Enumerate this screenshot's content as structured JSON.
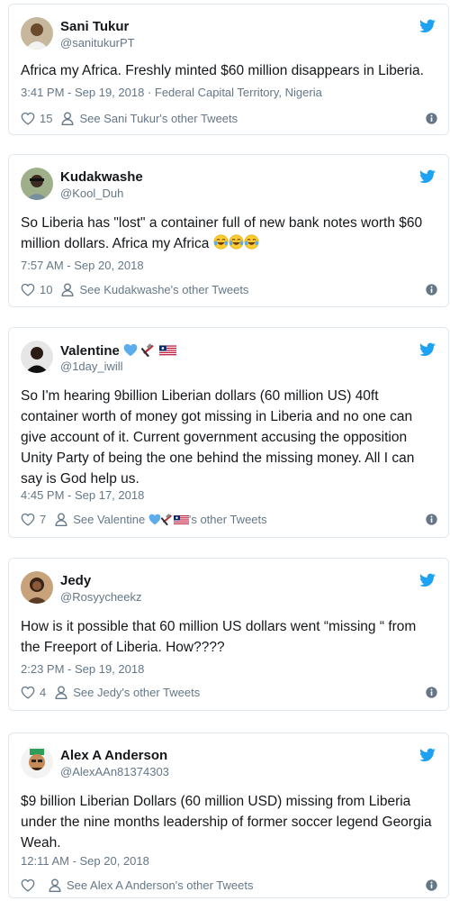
{
  "colors": {
    "twitter_blue": "#1da1f2",
    "muted": "#657786",
    "border": "#e1e8ed"
  },
  "tweets": [
    {
      "name": "Sani Tukur",
      "handle": "@sanitukurPT",
      "text": "Africa my Africa. Freshly minted $60 million disappears in Liberia.",
      "time": "3:41 PM - Sep 19, 2018",
      "location": "Federal Capital Territory, Nigeria",
      "likes": "15",
      "other_tweets": "See Sani Tukur's other Tweets"
    },
    {
      "name": "Kudakwashe",
      "handle": "@Kool_Duh",
      "text": "So Liberia has \"lost\" a container full of new bank notes worth $60 million dollars. Africa my Africa",
      "emojis": [
        "face-with-tears-of-joy",
        "face-with-tears-of-joy",
        "face-with-tears-of-joy"
      ],
      "time": "7:57 AM - Sep 20, 2018",
      "likes": "10",
      "other_tweets": "See Kudakwashe's other Tweets"
    },
    {
      "name": "Valentine",
      "name_emojis": [
        "blue-heart",
        "medicine-and-hammer",
        "liberia-flag"
      ],
      "handle": "@1day_iwill",
      "text": "So I'm hearing 9billion Liberian dollars (60 million US) 40ft container worth of money got missing in Liberia and no one can give account of it. Current government accusing the opposition Unity Party of being the one behind the missing money. All I can say is God help us.",
      "time": "4:45 PM - Sep 17, 2018",
      "likes": "7",
      "other_tweets_prefix": "See Valentine",
      "other_tweets_suffix": "'s other Tweets"
    },
    {
      "name": "Jedy",
      "handle": "@Rosyycheekz",
      "text": "How is it possible that 60 million US dollars went “missing “ from the Freeport of Liberia. How????",
      "time": "2:23 PM - Sep 19, 2018",
      "likes": "4",
      "other_tweets": "See Jedy's other Tweets"
    },
    {
      "name": "Alex A Anderson",
      "handle": "@AlexAAn81374303",
      "text": "$9 billion Liberian Dollars (60 million USD) missing from Liberia under the nine months leadership of former soccer legend Georgia Weah.",
      "time": "12:11 AM - Sep 20, 2018",
      "likes": "",
      "other_tweets": "See Alex A Anderson's other Tweets"
    }
  ]
}
